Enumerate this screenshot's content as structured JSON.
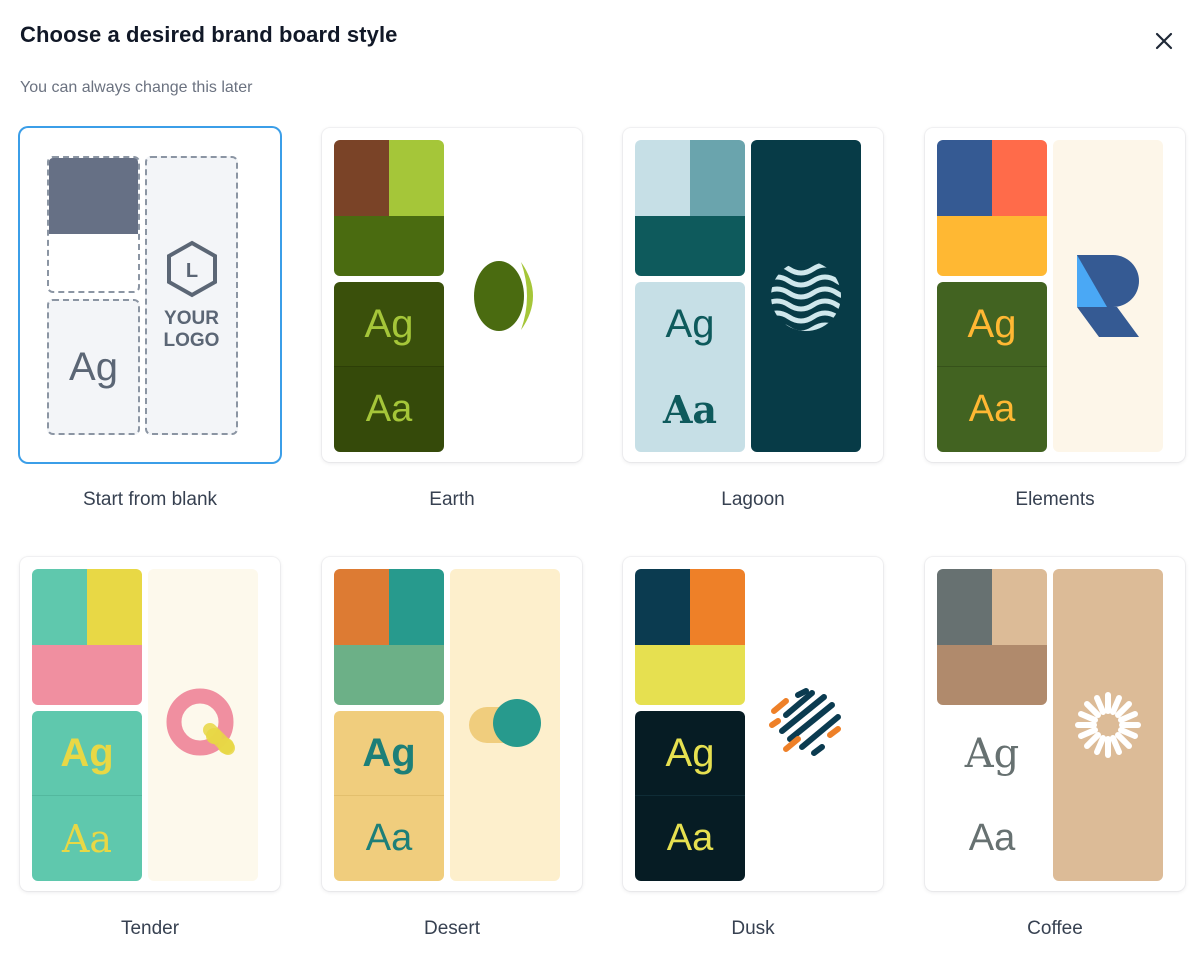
{
  "dialog": {
    "title": "Choose a desired brand board style",
    "subtitle": "You can always change this later",
    "close_icon": "close-icon"
  },
  "styles": [
    {
      "id": "blank",
      "label": "Start from blank",
      "selected": true,
      "type_sample": "Ag",
      "logo_text_line1": "YOUR",
      "logo_text_line2": "LOGO",
      "logo_letter": "L"
    },
    {
      "id": "earth",
      "label": "Earth",
      "type_top": "Ag",
      "type_bottom": "Aa"
    },
    {
      "id": "lagoon",
      "label": "Lagoon",
      "type_top": "Ag",
      "type_bottom": "Aa"
    },
    {
      "id": "elements",
      "label": "Elements",
      "type_top": "Ag",
      "type_bottom": "Aa"
    },
    {
      "id": "tender",
      "label": "Tender",
      "type_top": "Ag",
      "type_bottom": "Aa"
    },
    {
      "id": "desert",
      "label": "Desert",
      "type_top": "Ag",
      "type_bottom": "Aa"
    },
    {
      "id": "dusk",
      "label": "Dusk",
      "type_top": "Ag",
      "type_bottom": "Aa"
    },
    {
      "id": "coffee",
      "label": "Coffee",
      "type_top": "Ag",
      "type_bottom": "Aa"
    }
  ],
  "colors": {
    "selected_border": "#3b9ee8",
    "earth": [
      "#7a4327",
      "#a5c639",
      "#4a6b10",
      "#354a0a",
      "#a5c639"
    ],
    "lagoon": [
      "#c6dfe6",
      "#6aa4ad",
      "#0e5a5c",
      "#c6dfe6",
      "#073b47"
    ],
    "elements": [
      "#355a93",
      "#ff6b4a",
      "#ffb833",
      "#426321",
      "#fdf6e9"
    ],
    "tender": [
      "#5fc8ad",
      "#e8d845",
      "#f08fa0",
      "#5fc8ad",
      "#fdf9ec"
    ],
    "desert": [
      "#dd7b33",
      "#279a8d",
      "#6cb087",
      "#f0cd7d",
      "#fdefcc"
    ],
    "dusk": [
      "#0b3b50",
      "#ee8028",
      "#e6e050",
      "#061c24",
      "#ffffff"
    ],
    "coffee": [
      "#677171",
      "#dcbb97",
      "#b08a6c",
      "#ffffff",
      "#dcbb97"
    ]
  }
}
